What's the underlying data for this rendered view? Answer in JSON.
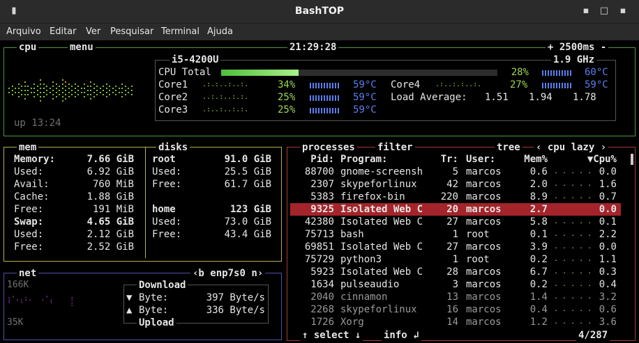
{
  "window": {
    "title": "BashTOP",
    "menu_icon": "hamburger-icon"
  },
  "menubar": [
    "Arquivo",
    "Editar",
    "Ver",
    "Pesquisar",
    "Terminal",
    "Ajuda"
  ],
  "cpu": {
    "label": "cpu",
    "menu_label": "menu",
    "clock": "21:29:28",
    "update": "+ 2500ms -",
    "model": "i5-4200U",
    "freq": "1.9 GHz",
    "uptime": "up 13:24",
    "total_label": "CPU Total",
    "total_pct": "28%",
    "total_temp": "60°C",
    "total_value": 0.28,
    "cores": [
      {
        "name": "Core1",
        "pct": "34%",
        "temp": "59°C"
      },
      {
        "name": "Core2",
        "pct": "25%",
        "temp": "59°C"
      },
      {
        "name": "Core3",
        "pct": "25%",
        "temp": "59°C"
      },
      {
        "name": "Core4",
        "pct": "27%",
        "temp": "59°C"
      }
    ],
    "load_label": "Load Average:",
    "load": [
      "1.51",
      "1.94",
      "1.78"
    ]
  },
  "mem": {
    "label": "mem",
    "rows": [
      {
        "k": "Memory:",
        "v": "7.66 GiB",
        "bold": true
      },
      {
        "k": "Used:",
        "v": "6.92 GiB"
      },
      {
        "k": "Avail:",
        "v": "760 MiB"
      },
      {
        "k": "Cache:",
        "v": "1.88 GiB"
      },
      {
        "k": "Free:",
        "v": "191 MiB"
      },
      {
        "k": "Swap:",
        "v": "4.65 GiB",
        "bold": true
      },
      {
        "k": "Used:",
        "v": "2.12 GiB"
      },
      {
        "k": "Free:",
        "v": "2.52 GiB"
      }
    ]
  },
  "disks": {
    "label": "disks",
    "items": [
      {
        "name": "root",
        "total": "91.0 GiB",
        "used": "25.5 GiB",
        "free": "61.7 GiB"
      },
      {
        "name": "home",
        "total": "123 GiB",
        "used": "73.0 GiB",
        "free": "43.4 GiB"
      }
    ],
    "used_label": "Used:",
    "free_label": "Free:"
  },
  "net": {
    "label": "net",
    "iface_prefix": "‹b",
    "iface": "enp7s0",
    "iface_suffix": "n›",
    "top_scale": "166K",
    "bottom_scale": "35K",
    "download_label": "Download",
    "upload_label": "Upload",
    "down_arrow": "▼",
    "up_arrow": "▲",
    "byte_label": "Byte:",
    "down_rate": "397 Byte/s",
    "up_rate": "336 Byte/s"
  },
  "proc": {
    "label": "processes",
    "filter_label": "filter",
    "tree_label": "tree",
    "sort_label": "‹ cpu lazy ›",
    "headers": {
      "pid": "Pid:",
      "program": "Program:",
      "tr": "Tr:",
      "user": "User:",
      "mem": "Mem%",
      "cpu": "▼Cpu%"
    },
    "rows": [
      {
        "pid": "88700",
        "program": "gnome-screensh",
        "tr": "5",
        "user": "marcos",
        "mem": "0.6",
        "cpu": "0.0"
      },
      {
        "pid": "2307",
        "program": "skypeforlinux",
        "tr": "42",
        "user": "marcos",
        "mem": "2.0",
        "cpu": "1.6"
      },
      {
        "pid": "5383",
        "program": "firefox-bin",
        "tr": "220",
        "user": "marcos",
        "mem": "8.9",
        "cpu": "0.7"
      },
      {
        "pid": "9325",
        "program": "Isolated Web C",
        "tr": "20",
        "user": "marcos",
        "mem": "2.7",
        "cpu": "0.0",
        "selected": true
      },
      {
        "pid": "42380",
        "program": "Isolated Web C",
        "tr": "27",
        "user": "marcos",
        "mem": "5.8",
        "cpu": "0.1"
      },
      {
        "pid": "75713",
        "program": "bash",
        "tr": "1",
        "user": "root",
        "mem": "0.1",
        "cpu": "2.2"
      },
      {
        "pid": "69851",
        "program": "Isolated Web C",
        "tr": "27",
        "user": "marcos",
        "mem": "3.9",
        "cpu": "0.0"
      },
      {
        "pid": "75729",
        "program": "python3",
        "tr": "1",
        "user": "root",
        "mem": "0.2",
        "cpu": "1.1"
      },
      {
        "pid": "5923",
        "program": "Isolated Web C",
        "tr": "28",
        "user": "marcos",
        "mem": "6.7",
        "cpu": "0.3"
      },
      {
        "pid": "1634",
        "program": "pulseaudio",
        "tr": "3",
        "user": "marcos",
        "mem": "0.2",
        "cpu": "0.4"
      },
      {
        "pid": "2040",
        "program": "cinnamon",
        "tr": "13",
        "user": "marcos",
        "mem": "1.4",
        "cpu": "3.2"
      },
      {
        "pid": "2268",
        "program": "skypeforlinux",
        "tr": "16",
        "user": "marcos",
        "mem": "0.4",
        "cpu": "0.6"
      },
      {
        "pid": "1726",
        "program": "Xorg",
        "tr": "14",
        "user": "marcos",
        "mem": "1.2",
        "cpu": "3.6"
      }
    ],
    "select_label": "↑ select ↓",
    "info_label": "info ↲",
    "count": "4/287"
  },
  "colors": {
    "cpu_box": "#4f9a3a",
    "mem_box": "#b7b24a",
    "net_box": "#4f4fb0",
    "proc_box": "#a83a3a",
    "selected": "#a3242a"
  }
}
